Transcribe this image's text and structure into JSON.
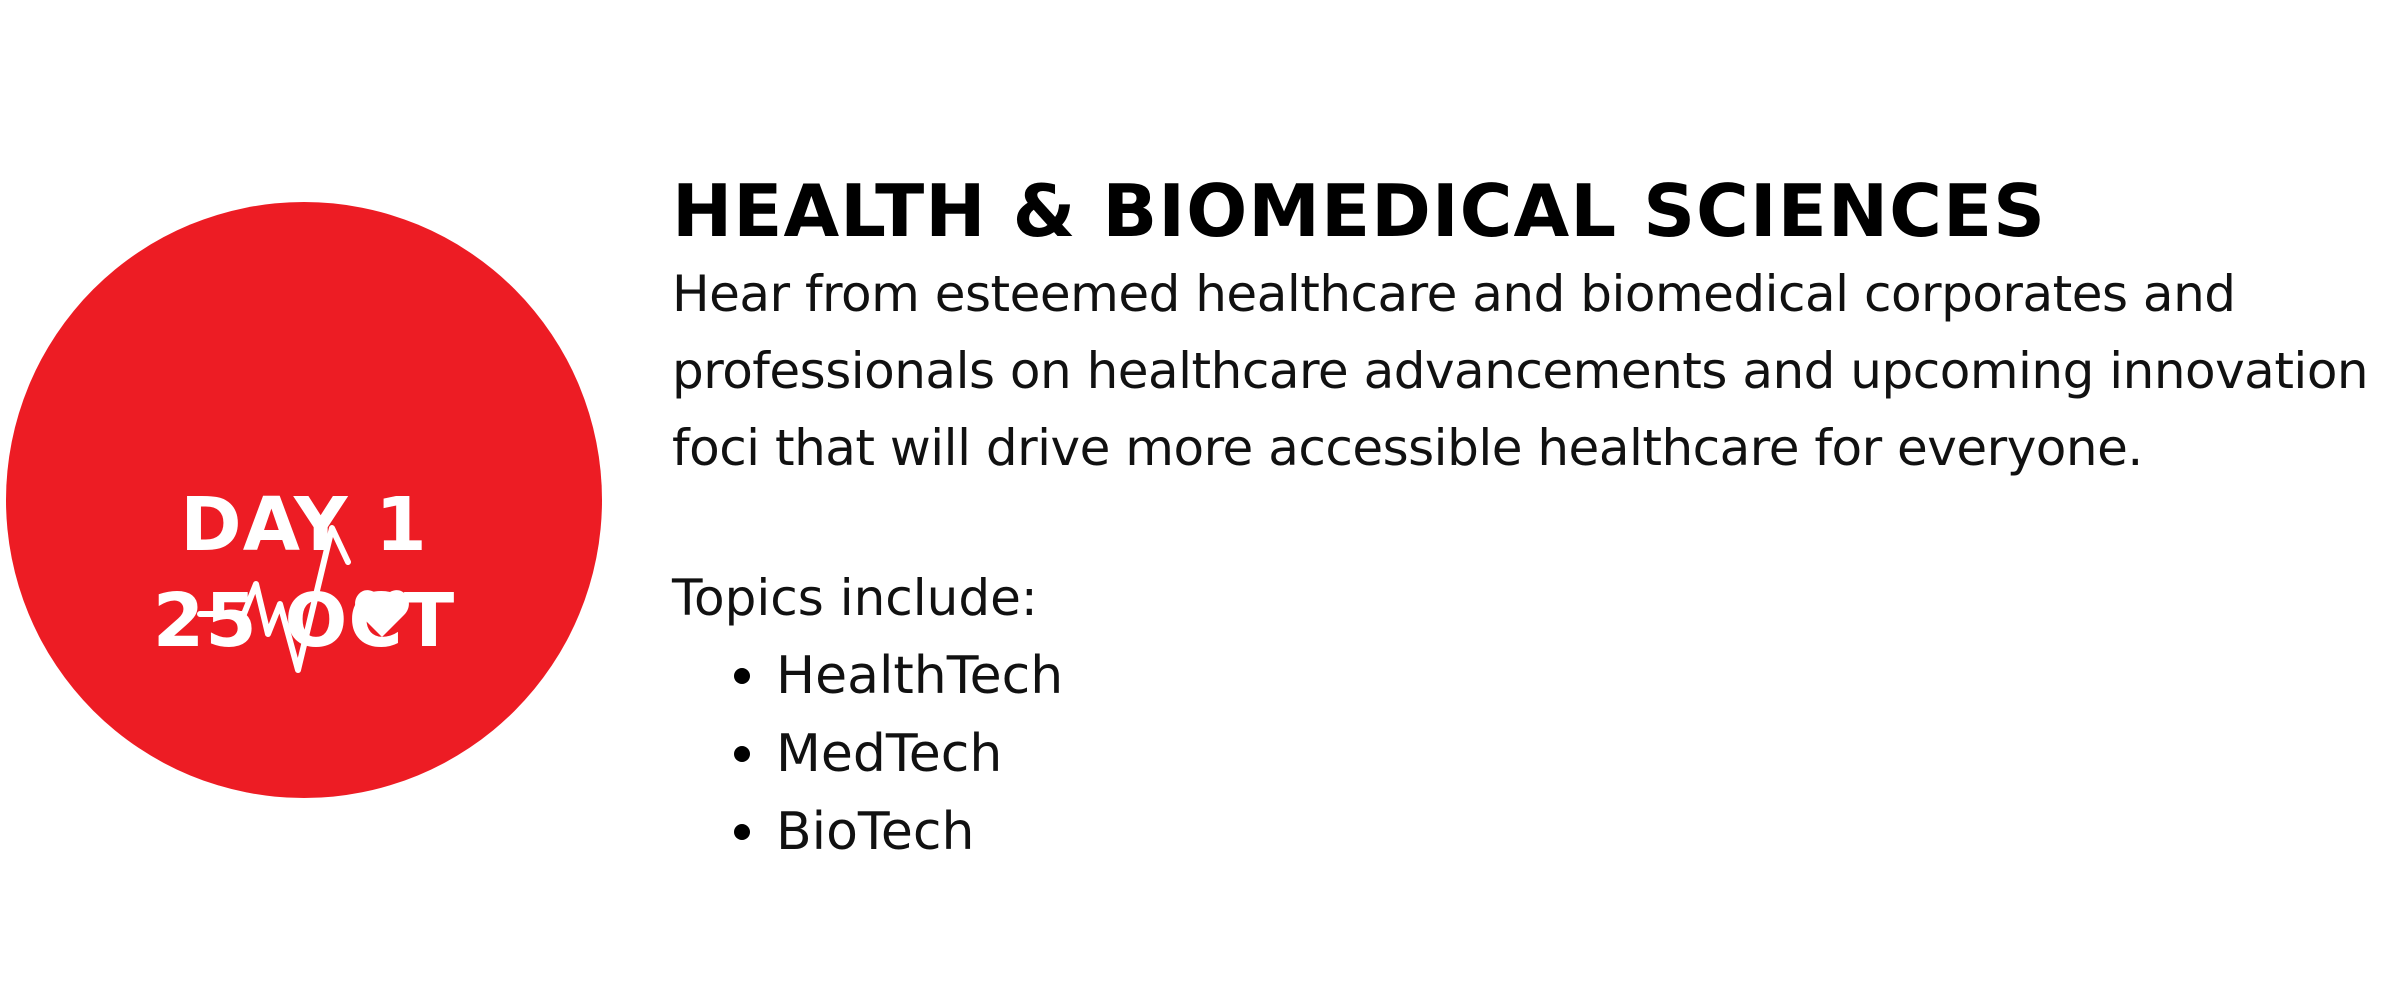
{
  "colors": {
    "accent": "#ed1c24",
    "text": "#000000",
    "badge_text": "#ffffff"
  },
  "badge": {
    "icon": "heartbeat-heart-icon",
    "day": "DAY 1",
    "date": "25 OCT"
  },
  "section": {
    "title": "HEALTH & BIOMEDICAL SCIENCES",
    "description_lines": [
      "Hear from esteemed healthcare and biomedical corporates and",
      "professionals on healthcare advancements and upcoming innovation",
      "foci that will drive more accessible healthcare for everyone."
    ],
    "topics_label": "Topics include:",
    "topics": [
      "HealthTech",
      "MedTech",
      "BioTech"
    ]
  }
}
